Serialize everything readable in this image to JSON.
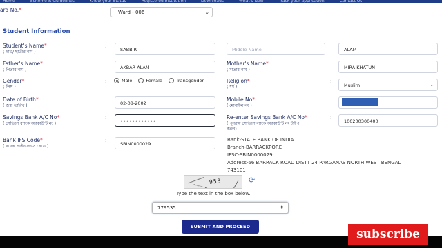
{
  "topnav": [
    "Home",
    "Scheme & Guidelines",
    "Know your Status",
    "Registered Institution",
    "Downloads",
    "What's New",
    "Track your application",
    "Contact Us"
  ],
  "ward": {
    "label": "ard No.",
    "value": "Ward - 006"
  },
  "section_title": "Student Information",
  "student_name": {
    "label": "Student's Name",
    "sub": "( ছাত্র/ ছাত্রীর নাম )",
    "first": "SABBIR",
    "middle_placeholder": "Middle Name",
    "last": "ALAM"
  },
  "father_name": {
    "label": "Father's Name",
    "sub": "( পিতার নাম )",
    "value": "AKBAR ALAM"
  },
  "mother_name": {
    "label": "Mother's Name",
    "sub": "( মাতার নাম )",
    "value": "MIRA KHATUN"
  },
  "gender": {
    "label": "Gender",
    "sub": "( লিঙ্গ )",
    "options": [
      "Male",
      "Female",
      "Transgender"
    ],
    "selected": "Male"
  },
  "religion": {
    "label": "Religion",
    "sub": "( ধর্ম )",
    "value": "Muslim"
  },
  "dob": {
    "label": "Date of Birth",
    "sub": "( জন্ম তারিখ )",
    "value": "02-08-2002"
  },
  "mobile": {
    "label": "Mobile No",
    "sub": "( মোবাইল নং )"
  },
  "savings": {
    "label": "Savings Bank A/C No",
    "sub": "( সেভিংস ব্যাংক অ্যাকাউন্ট নং )",
    "value": "••••••••••••"
  },
  "reenter": {
    "label": "Re-enter Savings Bank A/C No",
    "sub_line1": "( পুনরায় সেভিংস ব্যাংক অ্যাকাউন্ট নং টাইপ",
    "sub_line2": "করুন)",
    "value": "100200300400"
  },
  "ifsc": {
    "label": "Bank IFS Code",
    "sub": "( ব্যাংক আইএফএস কোড )",
    "value": "SBIN0000029"
  },
  "bank_info": [
    "Bank-STATE BANK OF INDIA",
    "Branch-BARRACKPORE",
    "IFSC-SBIN0000029",
    "Address-66 BARRACK ROAD DISTT 24 PARGANAS NORTH WEST BENGAL",
    "743101"
  ],
  "captcha": {
    "text": "953",
    "hint": "Type the text in the box below.",
    "value": "779535"
  },
  "submit_label": "SUBMIT AND PROCEED",
  "subscribe_label": "subscribe",
  "required_mark": "*",
  "colon": ":",
  "colors": {
    "primary": "#1b2a8c",
    "accent": "#2a4aa8",
    "required": "#e0263a",
    "subscribe": "#e11b1b"
  }
}
